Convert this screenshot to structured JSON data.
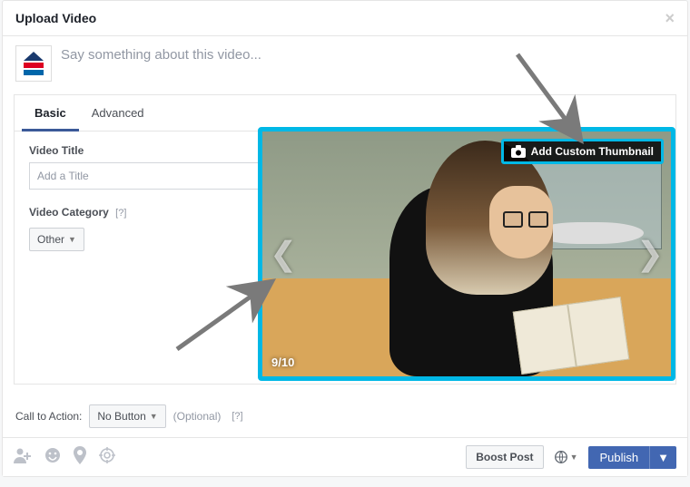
{
  "header": {
    "title": "Upload Video"
  },
  "caption": {
    "placeholder": "Say something about this video..."
  },
  "tabs": {
    "basic": "Basic",
    "advanced": "Advanced"
  },
  "fields": {
    "title_label": "Video Title",
    "title_placeholder": "Add a Title",
    "category_label": "Video Category",
    "category_help": "[?]",
    "category_value": "Other"
  },
  "preview": {
    "thumb_button": "Add Custom Thumbnail",
    "frame_count": "9/10"
  },
  "cta": {
    "label": "Call to Action:",
    "value": "No Button",
    "optional": "(Optional)",
    "help": "[?]"
  },
  "footer": {
    "boost": "Boost Post",
    "publish": "Publish"
  }
}
